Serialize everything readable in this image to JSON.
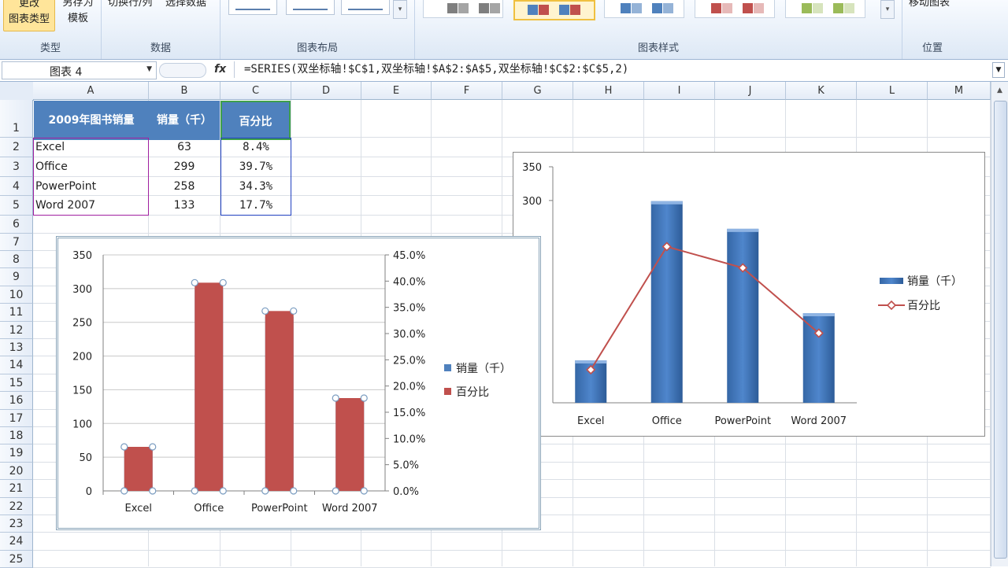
{
  "ribbon": {
    "groups": {
      "type": {
        "label": "类型",
        "btn_change_type_1": "更改",
        "btn_change_type_2": "图表类型",
        "btn_save_template_1": "另存为",
        "btn_save_template_2": "模板"
      },
      "data": {
        "label": "数据",
        "btn_switch": "切换行/列",
        "btn_select": "选择数据"
      },
      "layout": {
        "label": "图表布局"
      },
      "styles": {
        "label": "图表样式"
      },
      "location": {
        "label": "位置",
        "btn_move": "移动图表"
      }
    }
  },
  "formula_bar": {
    "name_box": "图表 4",
    "fx": "fx",
    "formula": "=SERIES(双坐标轴!$C$1,双坐标轴!$A$2:$A$5,双坐标轴!$C$2:$C$5,2)"
  },
  "columns": [
    "A",
    "B",
    "C",
    "D",
    "E",
    "F",
    "G",
    "H",
    "I",
    "J",
    "K",
    "L",
    "M"
  ],
  "rows": [
    "1",
    "2",
    "3",
    "4",
    "5",
    "6",
    "7",
    "8",
    "9",
    "10",
    "11",
    "12",
    "13",
    "14",
    "15",
    "16",
    "17",
    "18",
    "19",
    "20",
    "21",
    "22",
    "23",
    "24",
    "25"
  ],
  "table": {
    "headers": [
      "2009年图书销量",
      "销量（千）",
      "百分比"
    ],
    "rows": [
      [
        "Excel",
        "63",
        "8.4%"
      ],
      [
        "Office",
        "299",
        "39.7%"
      ],
      [
        "PowerPoint",
        "258",
        "34.3%"
      ],
      [
        "Word 2007",
        "133",
        "17.7%"
      ]
    ]
  },
  "colors": {
    "bar_blue": "#4f81bd",
    "bar_red": "#c0504d",
    "line_red": "#c0504d",
    "header_fill": "#4f81bd"
  },
  "chart_data": [
    {
      "type": "bar",
      "categories": [
        "Excel",
        "Office",
        "PowerPoint",
        "Word 2007"
      ],
      "series": [
        {
          "name": "销量（千）",
          "axis": "primary",
          "values": [
            63,
            299,
            258,
            133
          ]
        },
        {
          "name": "百分比",
          "axis": "secondary",
          "values": [
            0.084,
            0.397,
            0.343,
            0.177
          ]
        }
      ],
      "ylim": [
        0,
        350
      ],
      "yticks": [
        "0",
        "50",
        "100",
        "150",
        "200",
        "250",
        "300",
        "350"
      ],
      "y2lim": [
        0,
        0.45
      ],
      "y2ticks": [
        "0.0%",
        "5.0%",
        "10.0%",
        "15.0%",
        "20.0%",
        "25.0%",
        "30.0%",
        "35.0%",
        "40.0%",
        "45.0%"
      ],
      "legend": [
        "销量（千）",
        "百分比"
      ],
      "legend_position": "right",
      "grid": true
    },
    {
      "type": "bar+line",
      "categories": [
        "Excel",
        "Office",
        "PowerPoint",
        "Word 2007"
      ],
      "series": [
        {
          "name": "销量（千）",
          "type": "bar",
          "values": [
            63,
            299,
            258,
            133
          ]
        },
        {
          "name": "百分比",
          "type": "line",
          "values": [
            0.084,
            0.397,
            0.343,
            0.177
          ]
        }
      ],
      "ylim": [
        0,
        350
      ],
      "yticks": [
        "350",
        "300"
      ],
      "legend": [
        "销量（千）",
        "百分比"
      ],
      "legend_position": "right",
      "grid": false
    }
  ]
}
